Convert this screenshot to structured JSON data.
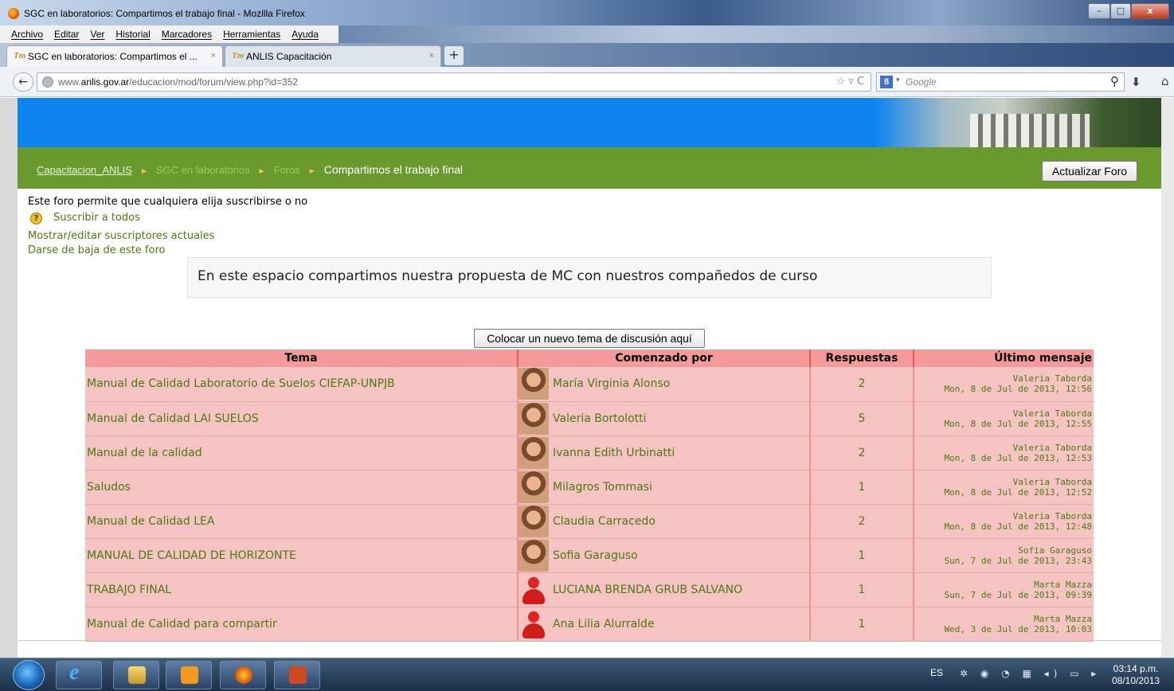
{
  "window": {
    "title": "SGC en laboratorios: Compartimos el trabajo final - Mozilla Firefox",
    "min": "–",
    "max": "□",
    "close": "x"
  },
  "menu": [
    "Archivo",
    "Editar",
    "Ver",
    "Historial",
    "Marcadores",
    "Herramientas",
    "Ayuda"
  ],
  "tabs": [
    {
      "label": "SGC en laboratorios: Compartimos el ...",
      "icon": "Tm",
      "close": "×"
    },
    {
      "label": "ANLIS Capacitación",
      "icon": "Tm",
      "close": "×"
    }
  ],
  "newtab": "+",
  "nav": {
    "back": "←",
    "url_prefix": "www.",
    "url_domain": "anlis.gov.ar",
    "url_path": "/educacion/mod/forum/view.php?id=352",
    "url_icons": "☆ ▿ C",
    "search_engine_icon": "8",
    "search_dropdown": "▾",
    "search_placeholder": "Google",
    "search_btn": "⚲",
    "download": "⬇",
    "home": "⌂"
  },
  "breadcrumb": {
    "c1": "Capacitacion_ANLIS",
    "c2": "SGC en laboratorios",
    "c3": "Foros",
    "c4": "Compartimos el trabajo final",
    "sep": "►"
  },
  "update_button": "Actualizar Foro",
  "subscription": {
    "info": "Este foro permite que cualquiera elija suscribirse o no",
    "help": "?",
    "subscribe_all": "Suscribir a todos",
    "show_edit": "Mostrar/editar suscriptores actuales",
    "unsubscribe": "Darse de baja de este foro"
  },
  "intro": "En este espacio compartimos nuestra propuesta de MC con nuestros compañedos de curso",
  "new_topic_button": "Colocar un nuevo tema de discusión aquí",
  "table": {
    "headers": [
      "Tema",
      "Comenzado por",
      "Respuestas",
      "Último mensaje"
    ],
    "rows": [
      {
        "topic": "Manual de Calidad Laboratorio de Suelos CIEFAP-UNPJB",
        "author": "María Virginia Alonso",
        "avatar": "photo",
        "replies": "2",
        "last_by": "Valeria Taborda",
        "last_date": "Mon, 8 de Jul de 2013, 12:56"
      },
      {
        "topic": "Manual de Calidad LAI SUELOS",
        "author": "Valeria Bortolotti",
        "avatar": "photo",
        "replies": "5",
        "last_by": "Valeria Taborda",
        "last_date": "Mon, 8 de Jul de 2013, 12:55"
      },
      {
        "topic": "Manual de la calidad",
        "author": "Ivanna Edith Urbinatti",
        "avatar": "photo",
        "replies": "2",
        "last_by": "Valeria Taborda",
        "last_date": "Mon, 8 de Jul de 2013, 12:53"
      },
      {
        "topic": "Saludos",
        "author": "Milagros Tommasi",
        "avatar": "photo",
        "replies": "1",
        "last_by": "Valeria Taborda",
        "last_date": "Mon, 8 de Jul de 2013, 12:52"
      },
      {
        "topic": "Manual de Calidad LEA",
        "author": "Claudia Carracedo",
        "avatar": "photo",
        "replies": "2",
        "last_by": "Valeria Taborda",
        "last_date": "Mon, 8 de Jul de 2013, 12:48"
      },
      {
        "topic": "MANUAL DE CALIDAD DE HORIZONTE",
        "author": "Sofia Garaguso",
        "avatar": "photo",
        "replies": "1",
        "last_by": "Sofia Garaguso",
        "last_date": "Sun, 7 de Jul de 2013, 23:43"
      },
      {
        "topic": "TRABAJO FINAL",
        "author": "LUCIANA BRENDA GRUB SALVANO",
        "avatar": "default-user",
        "replies": "1",
        "last_by": "Marta Mazza",
        "last_date": "Sun, 7 de Jul de 2013, 09:39"
      },
      {
        "topic": "Manual de Calidad para compartir",
        "author": "Ana Lilia Alurralde",
        "avatar": "default-user",
        "replies": "1",
        "last_by": "Marta Mazza",
        "last_date": "Wed, 3 de Jul de 2013, 10:03"
      }
    ]
  },
  "taskbar": {
    "ie_glyph": "e",
    "lang": "ES",
    "tray_icons": "✲ ◉ ◔ ▦ ◂) ▭ ▸",
    "time": "03:14 p.m.",
    "date": "08/10/2013"
  },
  "colors": {
    "banner": "#0d84f0",
    "navbar": "#6a9a2e",
    "table_header": "#f49a9a",
    "table_row": "#f6c3c3",
    "link": "#4a7a10"
  }
}
